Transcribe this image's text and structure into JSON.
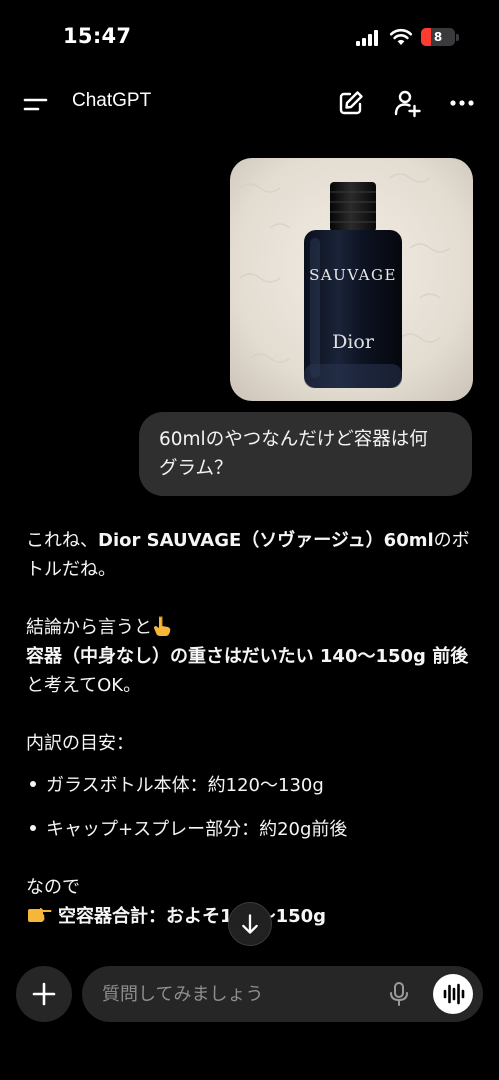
{
  "status_bar": {
    "time": "15:47",
    "battery_level": "8",
    "battery_color": "#ff3b30"
  },
  "header": {
    "title": "ChatGPT",
    "icons": [
      "menu-icon",
      "edit-icon",
      "add-person-icon",
      "more-icon"
    ]
  },
  "conversation": {
    "user_image": {
      "bottle_label": "SAUVAGE",
      "bottle_brand": "Dior"
    },
    "user_message": [
      "60mlのやつなんだけど容器は何",
      "グラム？"
    ],
    "reply": {
      "p1_prefix": "これね、",
      "p1_bold": "Dior SAUVAGE（ソヴァージュ）60ml",
      "p1_suffix": "のボトルだね。",
      "p2_line1": "結論から言うと",
      "p2_bold": "容器（中身なし）の重さはだいたい 140〜150g 前後",
      "p2_suffix": "と考えてOK。",
      "breakdown_heading": "内訳の目安：",
      "bullets": [
        "ガラスボトル本体：約120〜130g",
        "キャップ+スプレー部分：約20g前後"
      ],
      "conclusion_intro": "なので",
      "conclusion_bold": "空容器合計：およそ140〜150g"
    }
  },
  "composer": {
    "placeholder": "質問してみましょう"
  },
  "colors": {
    "background": "#000000",
    "bubble": "#2f2f2f",
    "composer": "#262626"
  }
}
